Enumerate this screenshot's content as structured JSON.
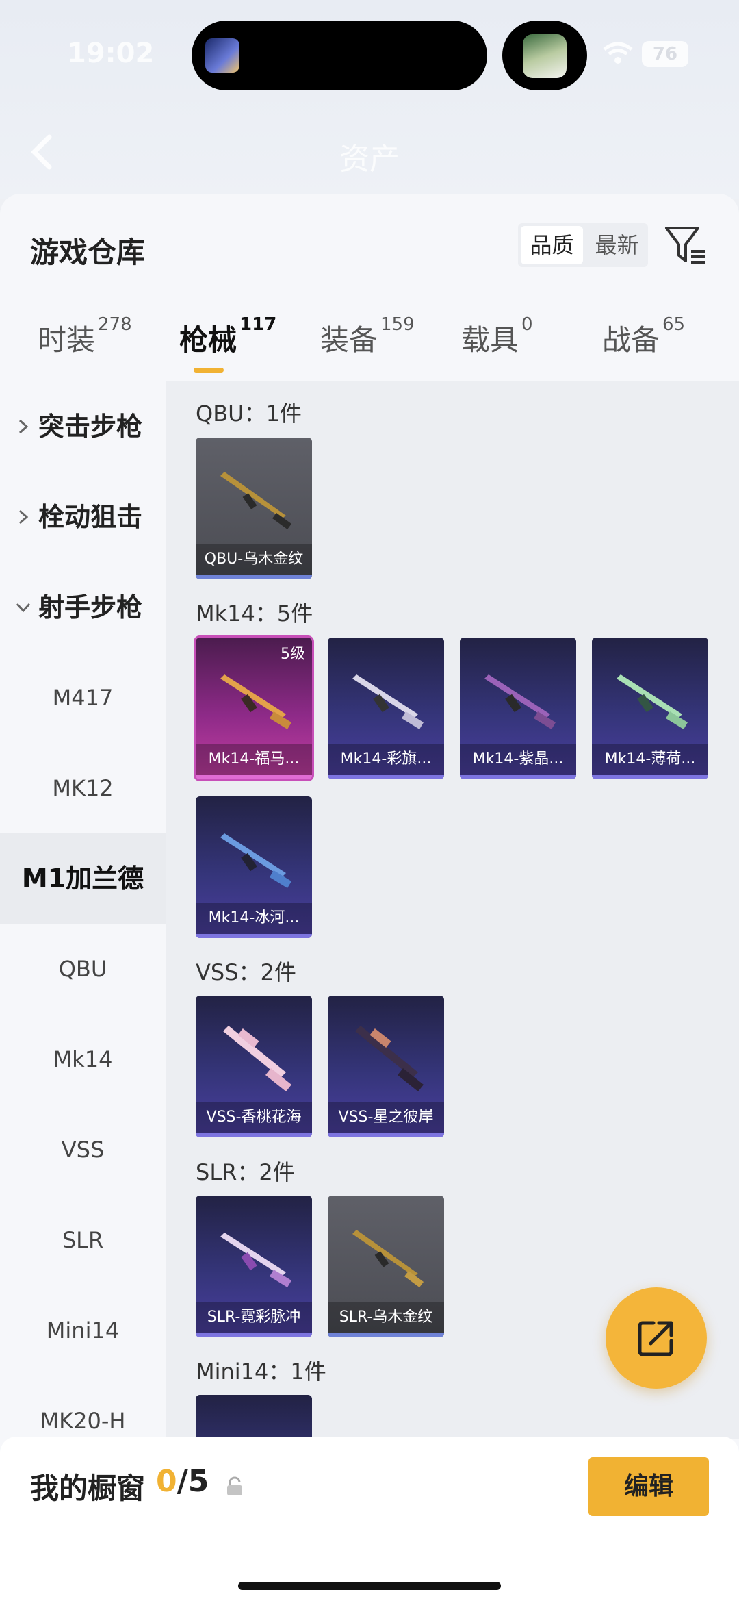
{
  "status": {
    "time": "19:02",
    "battery": "76"
  },
  "nav": {
    "title": "资产"
  },
  "header": {
    "title": "游戏仓库",
    "sort_options": [
      "品质",
      "最新"
    ]
  },
  "tabs": [
    {
      "label": "时装",
      "count": "278"
    },
    {
      "label": "枪械",
      "count": "117"
    },
    {
      "label": "装备",
      "count": "159"
    },
    {
      "label": "载具",
      "count": "0"
    },
    {
      "label": "战备",
      "count": "65"
    }
  ],
  "sidebar": {
    "categories": [
      "突击步枪",
      "栓动狙击",
      "射手步枪"
    ],
    "subitems": [
      "M417",
      "MK12",
      "M1加兰德",
      "QBU",
      "Mk14",
      "VSS",
      "SLR",
      "Mini14",
      "MK20-H"
    ]
  },
  "groups": [
    {
      "title": "QBU：1件",
      "items": [
        {
          "name": "QBU-乌木金纹",
          "style": "gray"
        }
      ]
    },
    {
      "title": "Mk14：5件",
      "items": [
        {
          "name": "Mk14-福马...",
          "style": "pink",
          "level": "5级"
        },
        {
          "name": "Mk14-彩旗...",
          "style": "purple"
        },
        {
          "name": "Mk14-紫晶...",
          "style": "purple"
        },
        {
          "name": "Mk14-薄荷...",
          "style": "purple"
        },
        {
          "name": "Mk14-冰河...",
          "style": "purple"
        }
      ]
    },
    {
      "title": "VSS：2件",
      "items": [
        {
          "name": "VSS-香桃花海",
          "style": "purple"
        },
        {
          "name": "VSS-星之彼岸",
          "style": "purple"
        }
      ]
    },
    {
      "title": "SLR：2件",
      "items": [
        {
          "name": "SLR-霓彩脉冲",
          "style": "purple"
        },
        {
          "name": "SLR-乌木金纹",
          "style": "gray"
        }
      ]
    },
    {
      "title": "Mini14：1件",
      "items": [
        {
          "name": "",
          "style": "purple"
        }
      ]
    }
  ],
  "showcase": {
    "label": "我的橱窗",
    "current": "0",
    "total": "/5",
    "edit_label": "编辑"
  },
  "colors": {
    "accent": "#f1b233",
    "card_purple": "#35357a",
    "card_gray": "#55565d",
    "card_pink": "#8e2a88"
  },
  "icons": [
    "back-icon",
    "filter-icon",
    "chevron-right-icon",
    "chevron-down-icon",
    "lock-icon",
    "share-icon",
    "wifi-icon"
  ]
}
